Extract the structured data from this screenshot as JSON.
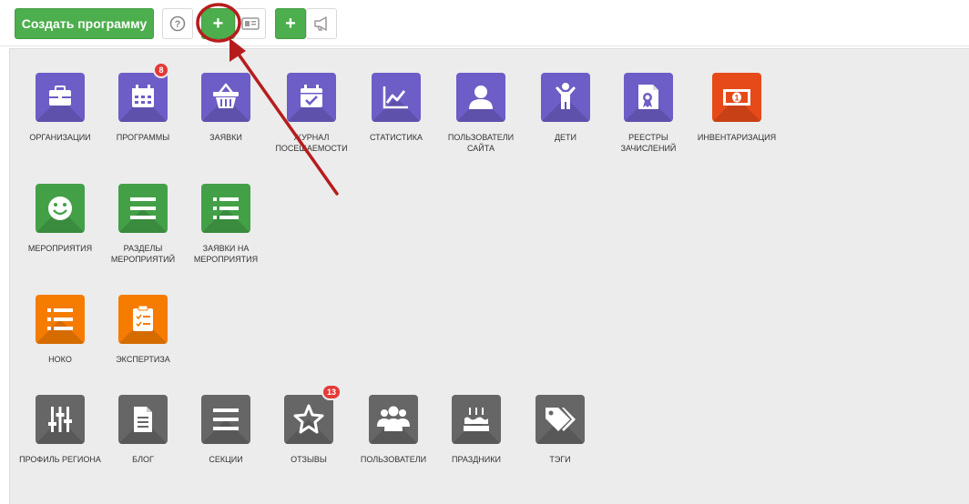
{
  "toolbar": {
    "create_label": "Создать программу",
    "help_glyph": "?",
    "plus_glyph": "+",
    "plus2_glyph": "+"
  },
  "badges": {
    "programs": "8",
    "reviews": "13"
  },
  "tiles": {
    "organizations": "ОРГАНИЗАЦИИ",
    "programs": "ПРОГРАММЫ",
    "applications": "ЗАЯВКИ",
    "attendance": "ЖУРНАЛ ПОСЕЩАЕМОСТИ",
    "statistics": "СТАТИСТИКА",
    "site_users": "ПОЛЬЗОВАТЕЛИ САЙТА",
    "children": "ДЕТИ",
    "enrollment_registries": "РЕЕСТРЫ ЗАЧИСЛЕНИЙ",
    "inventory": "ИНВЕНТАРИЗАЦИЯ",
    "events": "МЕРОПРИЯТИЯ",
    "event_sections": "РАЗДЕЛЫ МЕРОПРИЯТИЙ",
    "event_applications": "ЗАЯВКИ НА МЕРОПРИЯТИЯ",
    "noko": "НОКО",
    "expertise": "ЭКСПЕРТИЗА",
    "region_profile": "ПРОФИЛЬ РЕГИОНА",
    "blog": "БЛОГ",
    "sections": "СЕКЦИИ",
    "reviews": "ОТЗЫВЫ",
    "users": "ПОЛЬЗОВАТЕЛИ",
    "holidays": "ПРАЗДНИКИ",
    "tags": "ТЭГИ"
  },
  "colors": {
    "purple": "#6d5dc6",
    "red": "#e64a19",
    "green": "#43a047",
    "orange": "#f57c00",
    "gray": "#666666",
    "annotation": "#b71c1c"
  }
}
